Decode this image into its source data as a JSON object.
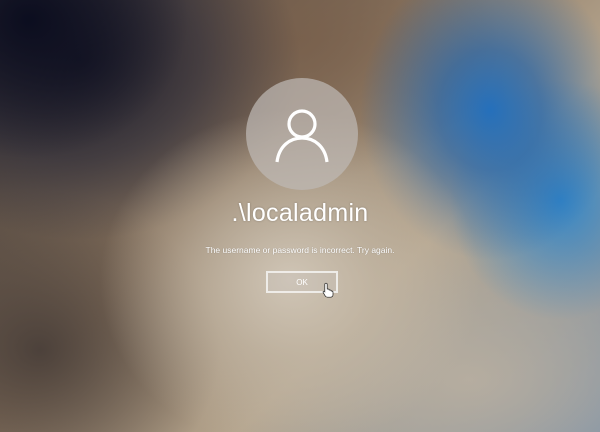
{
  "login": {
    "username": ".\\localadmin",
    "error_message": "The username or password is incorrect. Try again.",
    "ok_label": "OK"
  },
  "icons": {
    "avatar": "user-icon",
    "cursor": "hand-pointer-icon"
  },
  "colors": {
    "text": "#ffffff",
    "avatar_background": "#beb9b4",
    "accent_blue": "#1e6ebe"
  }
}
